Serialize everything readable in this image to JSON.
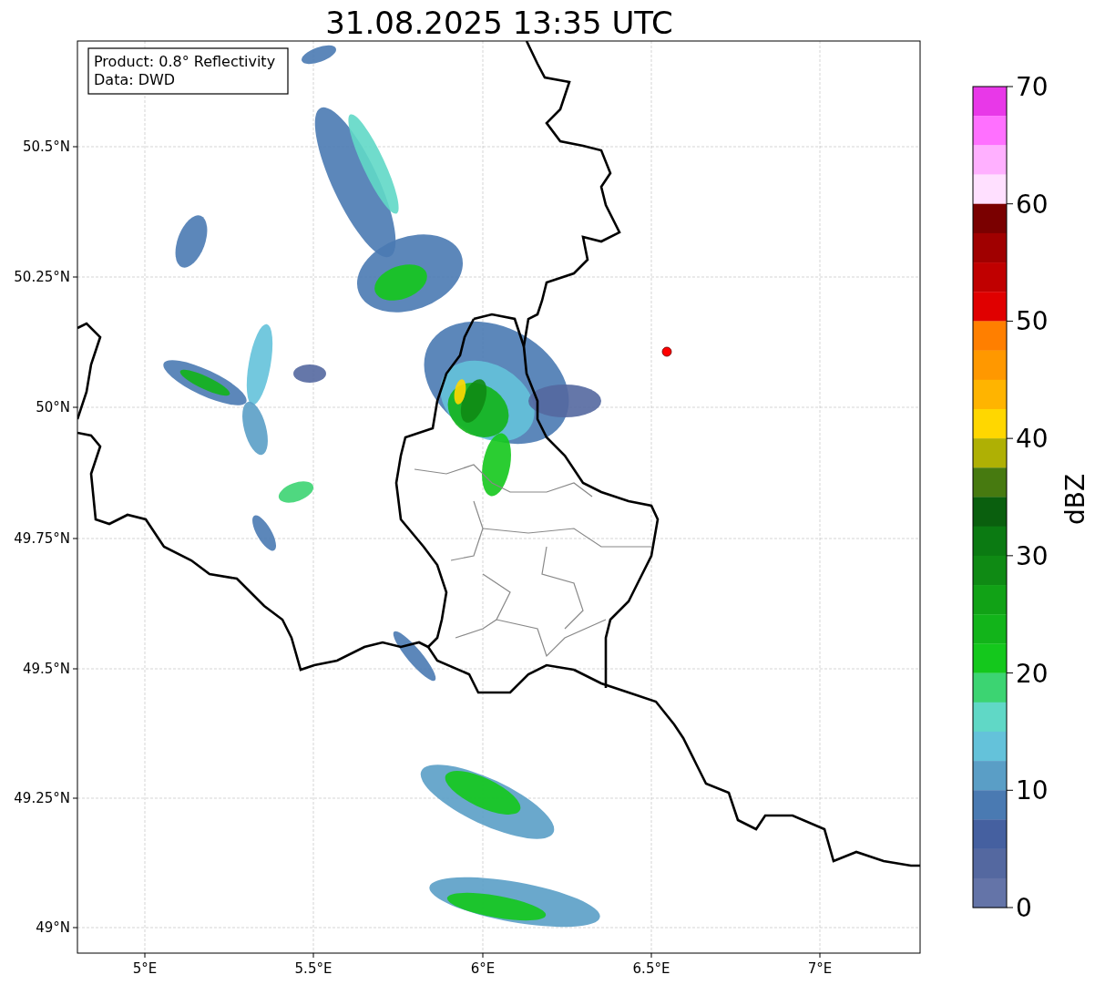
{
  "title": "31.08.2025 13:35 UTC",
  "info_box": [
    "Product: 0.8° Reflectivity",
    "Data: DWD"
  ],
  "x_tick_labels": [
    "5°E",
    "5.5°E",
    "6°E",
    "6.5°E",
    "7°E"
  ],
  "y_tick_labels": [
    "50.5°N",
    "50.25°N",
    "50°N",
    "49.75°N",
    "49.5°N",
    "49.25°N",
    "49°N"
  ],
  "colorbar": {
    "label": "dBZ",
    "tick_labels": [
      "70",
      "60",
      "50",
      "40",
      "30",
      "20",
      "10",
      "0"
    ],
    "bins": [
      {
        "color": "#e838e8"
      },
      {
        "color": "#ff70ff"
      },
      {
        "color": "#ffb0ff"
      },
      {
        "color": "#ffe0ff"
      },
      {
        "color": "#7a0000"
      },
      {
        "color": "#a00000"
      },
      {
        "color": "#c00000"
      },
      {
        "color": "#e00000"
      },
      {
        "color": "#ff7f00"
      },
      {
        "color": "#ff9800"
      },
      {
        "color": "#ffb400"
      },
      {
        "color": "#ffd700"
      },
      {
        "color": "#afb004"
      },
      {
        "color": "#477a10"
      },
      {
        "color": "#0a5f0e"
      },
      {
        "color": "#0b7a12"
      },
      {
        "color": "#0f8a14"
      },
      {
        "color": "#11a216"
      },
      {
        "color": "#12b41a"
      },
      {
        "color": "#14c81c"
      },
      {
        "color": "#3cd472"
      },
      {
        "color": "#60d8c6"
      },
      {
        "color": "#64c2da"
      },
      {
        "color": "#5a9ec6"
      },
      {
        "color": "#4a7ab2"
      },
      {
        "color": "#4560a0"
      },
      {
        "color": "#5468a0"
      },
      {
        "color": "#6474a8"
      }
    ]
  }
}
